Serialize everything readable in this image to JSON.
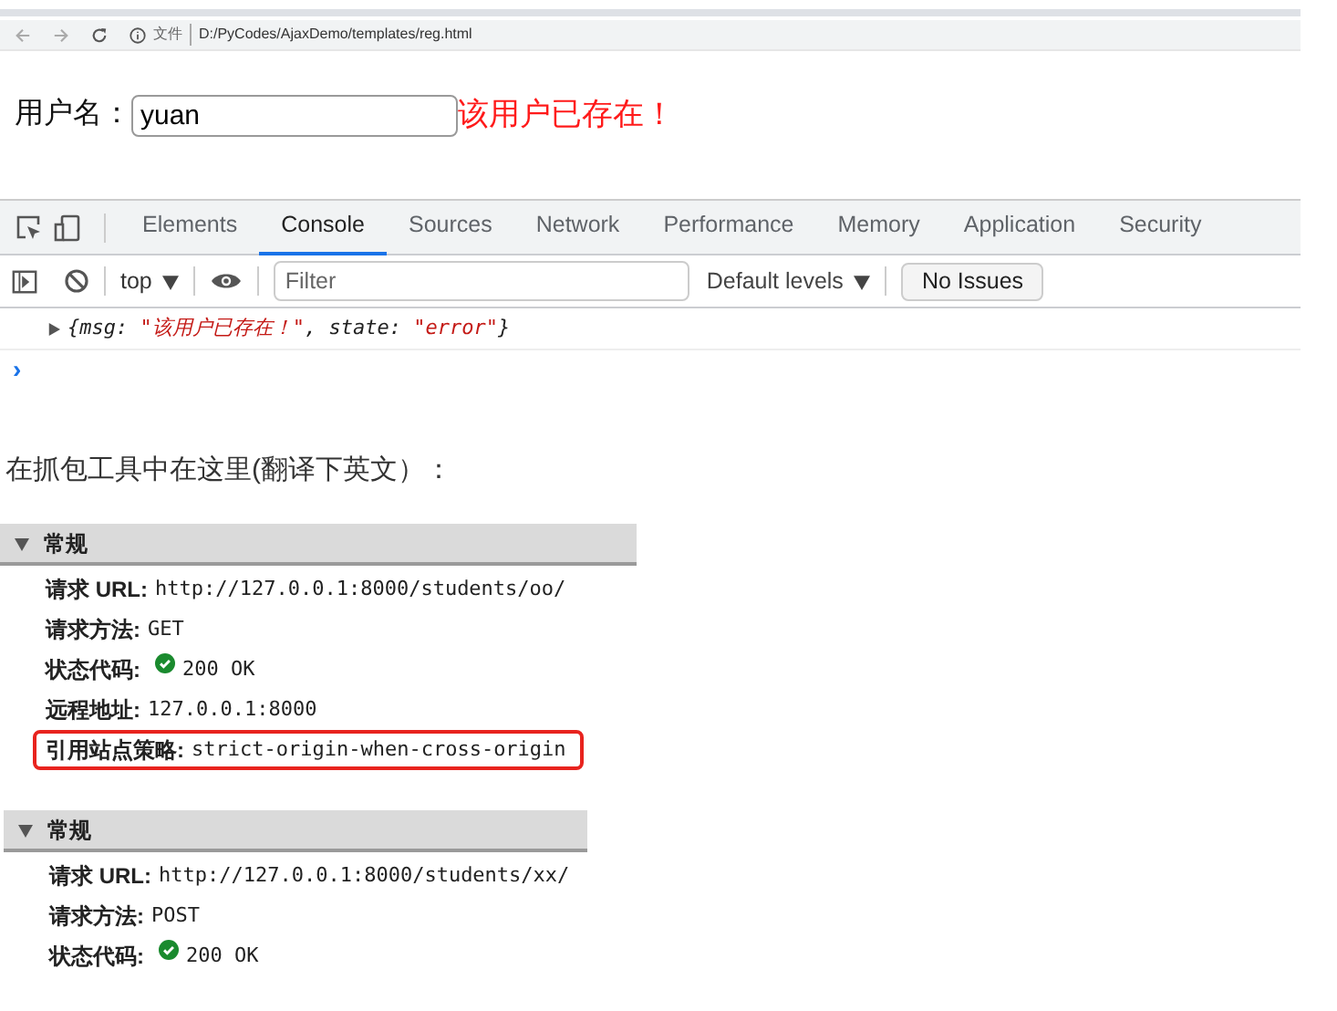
{
  "browser": {
    "file_label": "文件",
    "url": "D:/PyCodes/AjaxDemo/templates/reg.html"
  },
  "form": {
    "label": "用户名：",
    "value": "yuan",
    "error": "该用户已存在！"
  },
  "devtools": {
    "tabs": [
      {
        "label": "Elements",
        "selected": false
      },
      {
        "label": "Console",
        "selected": true
      },
      {
        "label": "Sources",
        "selected": false
      },
      {
        "label": "Network",
        "selected": false
      },
      {
        "label": "Performance",
        "selected": false
      },
      {
        "label": "Memory",
        "selected": false
      },
      {
        "label": "Application",
        "selected": false
      },
      {
        "label": "Security",
        "selected": false
      }
    ],
    "context": "top",
    "filter_placeholder": "Filter",
    "levels": "Default levels",
    "issues": "No Issues",
    "log": {
      "parts": [
        {
          "kind": "punct",
          "text": "{"
        },
        {
          "kind": "key",
          "text": "msg: "
        },
        {
          "kind": "string",
          "text": "\"该用户已存在！\""
        },
        {
          "kind": "punct",
          "text": ", "
        },
        {
          "kind": "key",
          "text": "state: "
        },
        {
          "kind": "string",
          "text": "\"error\""
        },
        {
          "kind": "punct",
          "text": "}"
        }
      ]
    },
    "prompt": "›"
  },
  "note": "在抓包工具中在这里(翻译下英文）：",
  "panels": [
    {
      "title": "常规",
      "expanded": true,
      "rows": [
        {
          "kind": "text",
          "label": "请求 URL:",
          "value": "http://127.0.0.1:8000/students/oo/",
          "highlighted": false
        },
        {
          "kind": "text",
          "label": "请求方法:",
          "value": "GET",
          "highlighted": false
        },
        {
          "kind": "status",
          "label": "状态代码:",
          "value": "200 OK",
          "highlighted": false
        },
        {
          "kind": "text",
          "label": "远程地址:",
          "value": "127.0.0.1:8000",
          "highlighted": false
        },
        {
          "kind": "text",
          "label": "引用站点策略:",
          "value": "strict-origin-when-cross-origin",
          "highlighted": true
        }
      ]
    },
    {
      "title": "常规",
      "expanded": true,
      "rows": [
        {
          "kind": "text",
          "label": "请求 URL:",
          "value": "http://127.0.0.1:8000/students/xx/",
          "highlighted": false
        },
        {
          "kind": "text",
          "label": "请求方法:",
          "value": "POST",
          "highlighted": false
        },
        {
          "kind": "status",
          "label": "状态代码:",
          "value": "200 OK",
          "highlighted": false
        }
      ]
    }
  ]
}
